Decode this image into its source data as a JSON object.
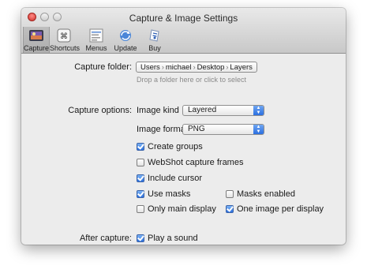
{
  "window": {
    "title": "Capture & Image Settings"
  },
  "toolbar": {
    "items": [
      {
        "label": "Capture",
        "icon": "camera-icon",
        "selected": true
      },
      {
        "label": "Shortcuts",
        "icon": "command-key-icon",
        "selected": false
      },
      {
        "label": "Menus",
        "icon": "menu-list-icon",
        "selected": false
      },
      {
        "label": "Update",
        "icon": "refresh-globe-icon",
        "selected": false
      },
      {
        "label": "Buy",
        "icon": "buy-icon",
        "selected": false
      }
    ]
  },
  "capture_folder": {
    "label": "Capture folder:",
    "path": [
      "Users",
      "michael",
      "Desktop",
      "Layers"
    ],
    "hint": "Drop a folder here or click to select"
  },
  "capture_options": {
    "label": "Capture options:",
    "image_kind": {
      "label": "Image kind",
      "value": "Layered"
    },
    "image_format": {
      "label": "Image format",
      "value": "PNG"
    },
    "create_groups": {
      "label": "Create groups",
      "checked": true
    },
    "webshot_frames": {
      "label": "WebShot capture frames",
      "checked": false
    },
    "include_cursor": {
      "label": "Include cursor",
      "checked": true
    },
    "use_masks": {
      "label": "Use masks",
      "checked": true
    },
    "masks_enabled": {
      "label": "Masks enabled",
      "checked": false
    },
    "only_main_display": {
      "label": "Only main display",
      "checked": false
    },
    "one_image_per_display": {
      "label": "One image per display",
      "checked": true
    }
  },
  "after_capture": {
    "label": "After capture:",
    "play_sound": {
      "label": "Play a sound",
      "checked": true
    }
  },
  "colors": {
    "accent": "#2d71de",
    "toolbar_top": "#e9e9e9",
    "toolbar_bottom": "#c8c8c8"
  }
}
